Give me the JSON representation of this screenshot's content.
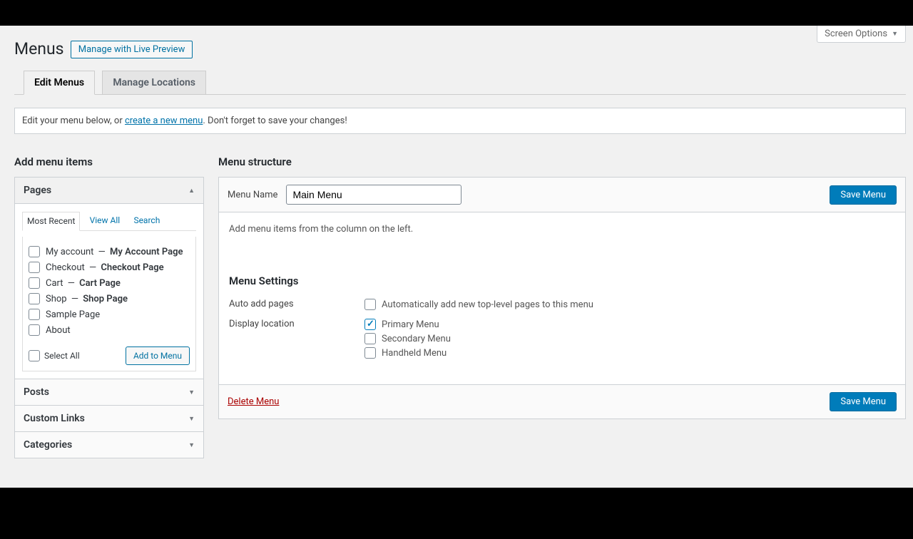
{
  "screen_options_label": "Screen Options",
  "page_title": "Menus",
  "live_preview_button": "Manage with Live Preview",
  "tabs": {
    "edit": "Edit Menus",
    "locations": "Manage Locations"
  },
  "manage_menus_prefix": "Edit your menu below, or ",
  "manage_menus_link": "create a new menu",
  "manage_menus_suffix": ". Don't forget to save your changes!",
  "add_items_heading": "Add menu items",
  "accordion": {
    "pages": "Pages",
    "posts": "Posts",
    "custom_links": "Custom Links",
    "categories": "Categories"
  },
  "sub_tabs": {
    "most_recent": "Most Recent",
    "view_all": "View All",
    "search": "Search"
  },
  "pages_list": [
    {
      "label": "My account",
      "strong": "My Account Page",
      "sep": "—"
    },
    {
      "label": "Checkout",
      "strong": "Checkout Page",
      "sep": "—"
    },
    {
      "label": "Cart",
      "strong": "Cart Page",
      "sep": "—"
    },
    {
      "label": "Shop",
      "strong": "Shop Page",
      "sep": "—"
    },
    {
      "label": "Sample Page",
      "strong": "",
      "sep": ""
    },
    {
      "label": "About",
      "strong": "",
      "sep": ""
    }
  ],
  "select_all": "Select All",
  "add_to_menu": "Add to Menu",
  "menu_structure_heading": "Menu structure",
  "menu_name_label": "Menu Name",
  "menu_name_value": "Main Menu",
  "save_menu": "Save Menu",
  "from_left_hint": "Add menu items from the column on the left.",
  "menu_settings_heading": "Menu Settings",
  "auto_add_label": "Auto add pages",
  "auto_add_cb": "Automatically add new top-level pages to this menu",
  "display_location_label": "Display location",
  "locations": [
    "Primary Menu",
    "Secondary Menu",
    "Handheld Menu"
  ],
  "delete_menu": "Delete Menu"
}
